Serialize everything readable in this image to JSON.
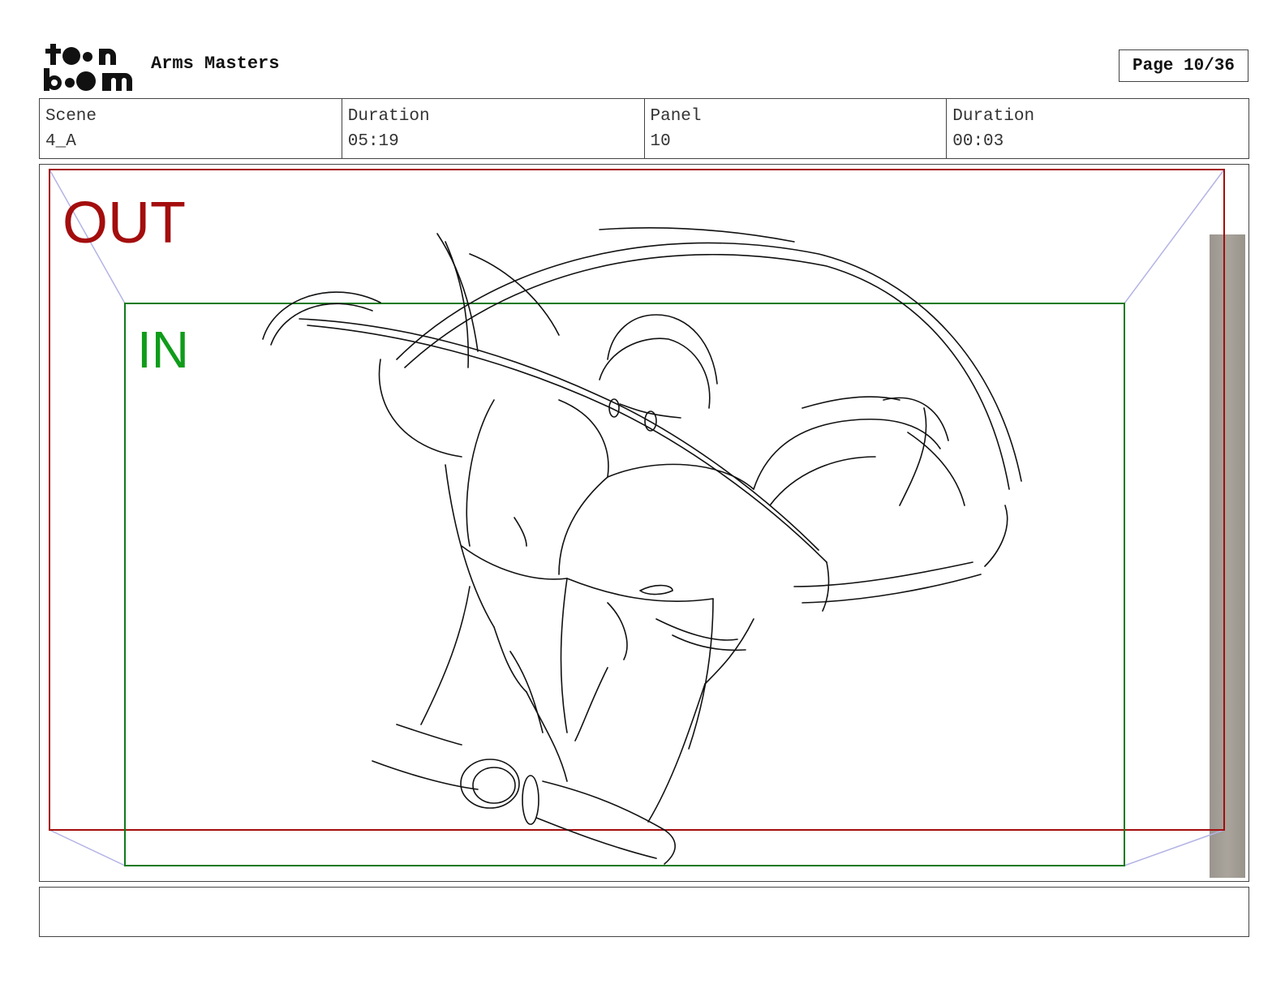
{
  "header": {
    "logo_text": "toon boom",
    "project_title": "Arms Masters",
    "page_label": "Page 10/36"
  },
  "info": {
    "scene_label": "Scene",
    "scene_value": "4_A",
    "scene_duration_label": "Duration",
    "scene_duration_value": "05:19",
    "panel_label": "Panel",
    "panel_value": "10",
    "panel_duration_label": "Duration",
    "panel_duration_value": "00:03"
  },
  "panel": {
    "out_label": "OUT",
    "in_label": "IN",
    "out_color": "#a40d0d",
    "in_color": "#0f9c1a",
    "guide_color": "#b3b3e6",
    "sketch_subject": "muscular figure flexing arms"
  },
  "caption": {
    "text": ""
  }
}
